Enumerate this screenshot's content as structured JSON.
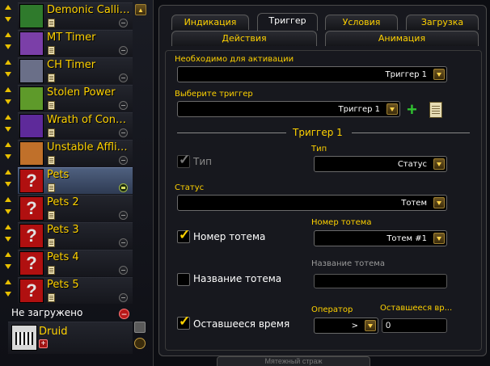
{
  "aura_list": {
    "items": [
      {
        "name": "Demonic Calling...",
        "icon": "demon-icon",
        "color": "#2f7a2c",
        "selected": false,
        "active": false
      },
      {
        "name": "MT Timer",
        "icon": "mage-icon",
        "color": "#7b3fa8",
        "selected": false,
        "active": false
      },
      {
        "name": "CH Timer",
        "icon": "gear-spell-icon",
        "color": "#6a6f88",
        "selected": false,
        "active": false
      },
      {
        "name": "Stolen Power",
        "icon": "skull-icon",
        "color": "#5e9a2a",
        "selected": false,
        "active": false
      },
      {
        "name": "Wrath of Consu...",
        "icon": "purple-cloak-icon",
        "color": "#5e2a9a",
        "selected": false,
        "active": false
      },
      {
        "name": "Unstable Affliction",
        "icon": "fire-face-icon",
        "color": "#c0702a",
        "selected": false,
        "active": false
      },
      {
        "name": "Pets",
        "icon": "question-mark-icon",
        "color": "#b01010",
        "selected": true,
        "active": true
      },
      {
        "name": "Pets 2",
        "icon": "question-mark-icon",
        "color": "#b01010",
        "selected": false,
        "active": false
      },
      {
        "name": "Pets 3",
        "icon": "question-mark-icon",
        "color": "#b01010",
        "selected": false,
        "active": false
      },
      {
        "name": "Pets 4",
        "icon": "question-mark-icon",
        "color": "#b01010",
        "selected": false,
        "active": false
      },
      {
        "name": "Pets 5",
        "icon": "question-mark-icon",
        "color": "#b01010",
        "selected": false,
        "active": false
      }
    ],
    "unloaded_label": "Не загружено",
    "druid": {
      "name": "Druid"
    }
  },
  "tabs_row1": [
    "Индикация",
    "Триггер",
    "Условия",
    "Загрузка"
  ],
  "tabs_row2": [
    "Действия",
    "Анимация"
  ],
  "active_tab": "Триггер",
  "trigger": {
    "required_label": "Необходимо для активации",
    "required_value": "Триггер 1",
    "choose_label": "Выберите триггер",
    "choose_value": "Триггер 1",
    "section_title": "Триггер 1",
    "type_checkbox_label": "Тип",
    "type_label": "Тип",
    "type_value": "Статус",
    "status_label": "Статус",
    "status_value": "Тотем",
    "totem_number_checkbox_label": "Номер тотема",
    "totem_number_label": "Номер тотема",
    "totem_number_value": "Тотем #1",
    "totem_name_checkbox_label": "Название тотема",
    "totem_name_label": "Название тотема",
    "totem_name_value": "",
    "remaining_checkbox_label": "Оставшееся время",
    "operator_label": "Оператор",
    "operator_value": ">",
    "remaining_label": "Оставшееся вр...",
    "remaining_value": "0"
  },
  "footer_tab": "Мятежный страж"
}
